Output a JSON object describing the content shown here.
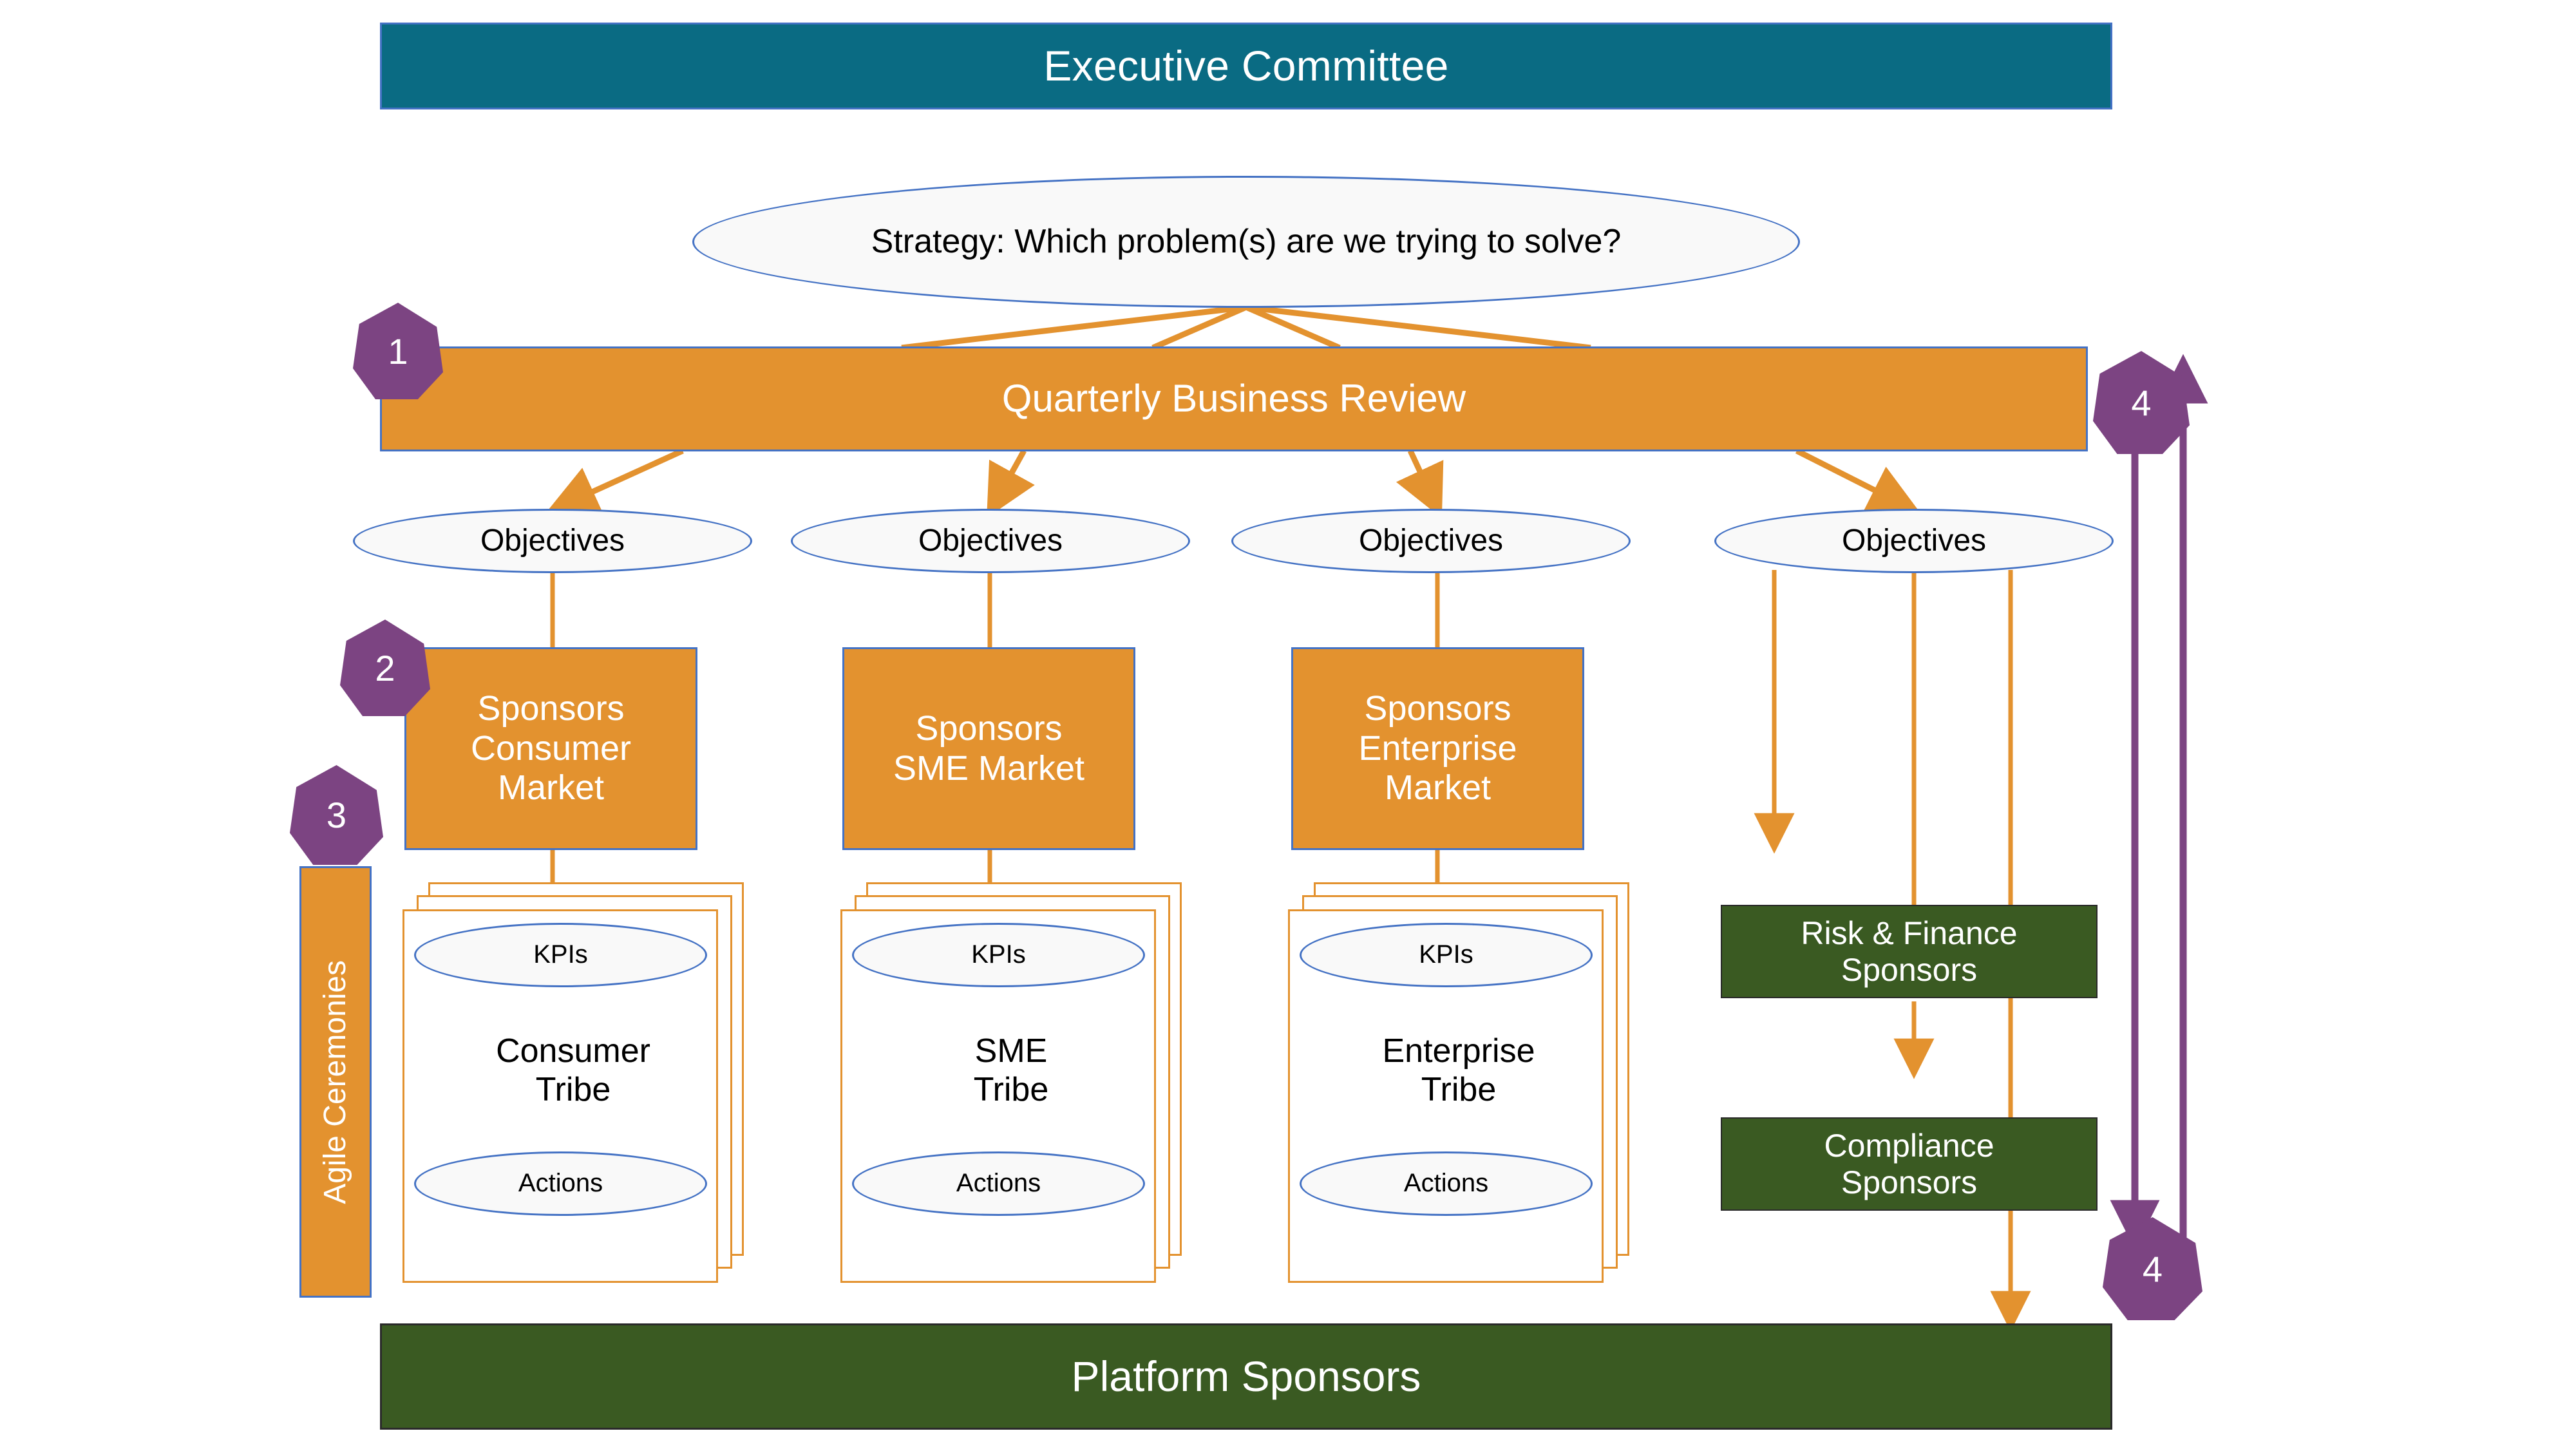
{
  "diagram": {
    "title": "Executive Committee governance and agile operating model",
    "colors": {
      "teal": "#0A6B83",
      "orange": "#E3922F",
      "green": "#3A5A22",
      "purple": "#7C4482",
      "blue_outline": "#4472C4",
      "ellipse_fill": "#F9F9F9",
      "white_text": "#FFFFFF",
      "black_text": "#000000"
    }
  },
  "header": {
    "label": "Executive Committee"
  },
  "strategy": {
    "label": "Strategy: Which problem(s) are we trying to solve?"
  },
  "qbr": {
    "label": "Quarterly Business Review"
  },
  "agile_ceremonies": {
    "label": "Agile Ceremonies"
  },
  "footer": {
    "label": "Platform Sponsors"
  },
  "badges": [
    {
      "label": "1",
      "name": "badge-1-qbr"
    },
    {
      "label": "2",
      "name": "badge-2-sponsors"
    },
    {
      "label": "3",
      "name": "badge-3-agile-ceremonies"
    },
    {
      "label": "4",
      "name": "badge-4-top"
    },
    {
      "label": "4",
      "name": "badge-4-bottom"
    }
  ],
  "objectives": [
    {
      "label": "Objectives"
    },
    {
      "label": "Objectives"
    },
    {
      "label": "Objectives"
    },
    {
      "label": "Objectives"
    }
  ],
  "sponsor_blocks": [
    {
      "label": "Sponsors\nConsumer\nMarket",
      "line1": "Sponsors",
      "line2": "Consumer",
      "line3": "Market"
    },
    {
      "label": "Sponsors\nSME Market",
      "line1": "Sponsors",
      "line2": "SME Market",
      "line3": ""
    },
    {
      "label": "Sponsors\nEnterprise\nMarket",
      "line1": "Sponsors",
      "line2": "Enterprise",
      "line3": "Market"
    }
  ],
  "tribes": [
    {
      "kpis_label": "KPIs",
      "title_line1": "Consumer",
      "title_line2": "Tribe",
      "actions_label": "Actions"
    },
    {
      "kpis_label": "KPIs",
      "title_line1": "SME",
      "title_line2": "Tribe",
      "actions_label": "Actions"
    },
    {
      "kpis_label": "KPIs",
      "title_line1": "Enterprise",
      "title_line2": "Tribe",
      "actions_label": "Actions"
    }
  ],
  "governance_blocks": [
    {
      "line1": "Risk & Finance",
      "line2": "Sponsors"
    },
    {
      "line1": "Compliance",
      "line2": "Sponsors"
    }
  ]
}
